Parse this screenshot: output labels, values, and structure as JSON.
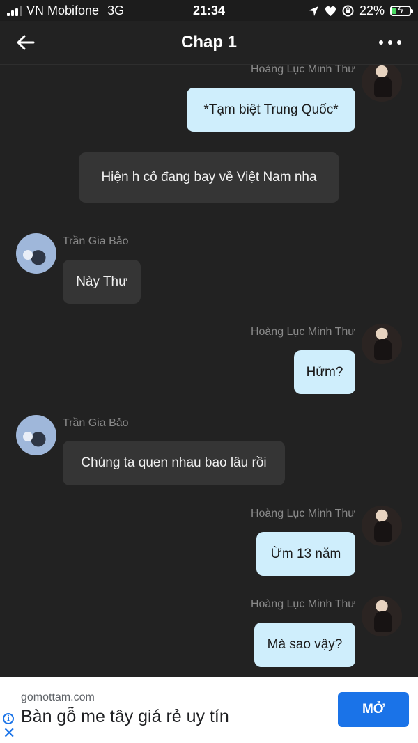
{
  "status_bar": {
    "carrier": "VN Mobifone",
    "network": "3G",
    "time": "21:34",
    "battery": "22%",
    "battery_level": 0.22
  },
  "header": {
    "title": "Chap 1",
    "back_icon": "arrow-left-icon",
    "more_icon": "more-dots-icon"
  },
  "messages": [
    {
      "sender": "Hoàng Lục Minh Thư",
      "text": "*Tạm biệt Trung Quốc*",
      "side": "right"
    },
    {
      "sender": "",
      "text": "Hiện h cô đang bay về Việt Nam nha",
      "side": "center"
    },
    {
      "sender": "Trần Gia Bảo",
      "text": "Này Thư",
      "side": "left"
    },
    {
      "sender": "Hoàng Lục Minh Thư",
      "text": "Hửm?",
      "side": "right"
    },
    {
      "sender": "Trần Gia Bảo",
      "text": "Chúng ta quen nhau bao lâu rồi",
      "side": "left"
    },
    {
      "sender": "Hoàng Lục Minh Thư",
      "text": "Ừm 13 năm",
      "side": "right"
    },
    {
      "sender": "Hoàng Lục Minh Thư",
      "text": "Mà sao vậy?",
      "side": "right"
    }
  ],
  "ad": {
    "domain": "gomottam.com",
    "headline": "Bàn gỗ me tây giá rẻ uy tín",
    "cta": "MỞ"
  },
  "colors": {
    "background": "#222222",
    "my_bubble": "#cfeefc",
    "other_bubble": "#353535",
    "ad_button": "#1a73e8"
  }
}
